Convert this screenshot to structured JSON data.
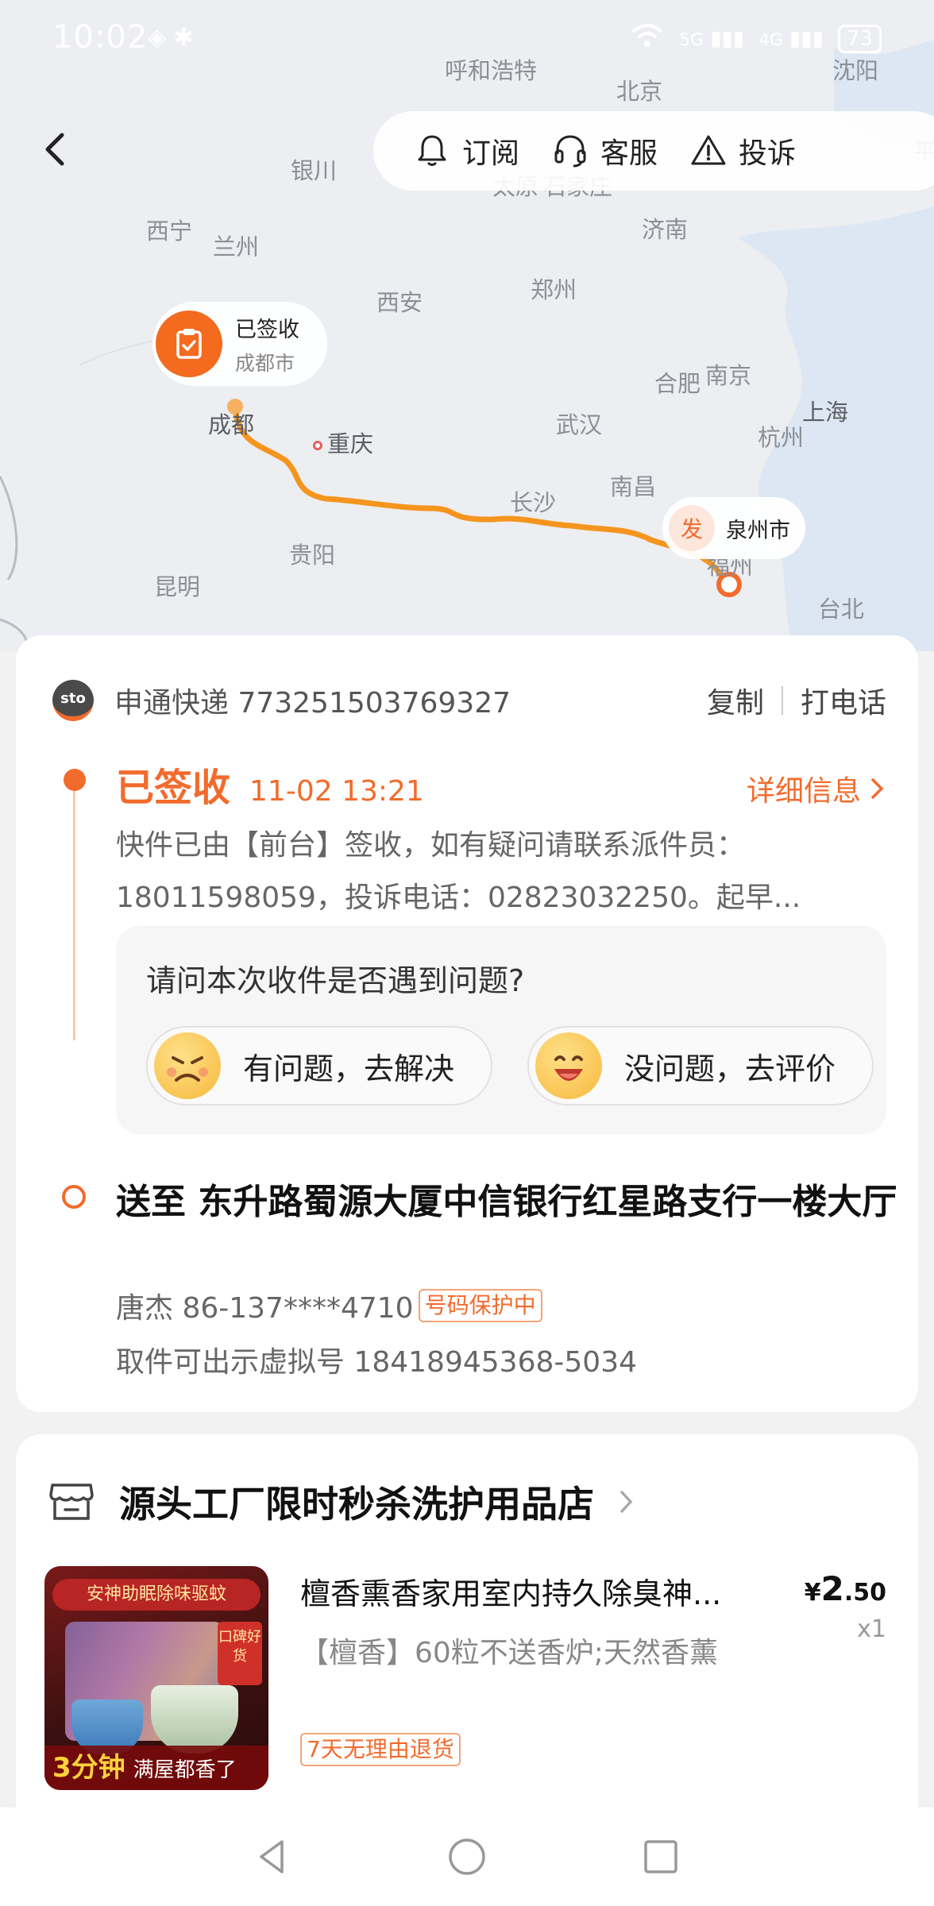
{
  "status_bar": {
    "time": "10:02",
    "network": "5G",
    "network2": "4G",
    "battery": "73"
  },
  "map": {
    "cities": [
      {
        "name": "呼和浩特"
      },
      {
        "name": "北京"
      },
      {
        "name": "沈阳"
      },
      {
        "name": "银川"
      },
      {
        "name": "太原"
      },
      {
        "name": "石家庄"
      },
      {
        "name": "西宁"
      },
      {
        "name": "兰州"
      },
      {
        "name": "济南"
      },
      {
        "name": "西安"
      },
      {
        "name": "郑州"
      },
      {
        "name": "合肥"
      },
      {
        "name": "南京"
      },
      {
        "name": "上海"
      },
      {
        "name": "成都"
      },
      {
        "name": "重庆"
      },
      {
        "name": "武汉"
      },
      {
        "name": "杭州"
      },
      {
        "name": "长沙"
      },
      {
        "name": "南昌"
      },
      {
        "name": "贵阳"
      },
      {
        "name": "昆明"
      },
      {
        "name": "福州"
      },
      {
        "name": "台北"
      },
      {
        "name": "平"
      }
    ],
    "signed_badge": {
      "label": "已签收",
      "city": "成都市"
    },
    "origin_badge": {
      "icon_text": "发",
      "city": "泉州市"
    },
    "route_color": "#f5951e"
  },
  "topbar": {
    "subscribe": "订阅",
    "service": "客服",
    "complaint": "投诉"
  },
  "shipment": {
    "courier_logo": "sto",
    "courier": "申通快递 773251503769327",
    "copy": "复制",
    "call": "打电话",
    "status": "已签收",
    "status_time": "11-02 13:21",
    "detail_link": "详细信息",
    "desc_line1": "快件已由【前台】签收，如有疑问请联系派件员：",
    "desc_line2": "18011598059，投诉电话：02823032250。起早...",
    "survey_question": "请问本次收件是否遇到问题?",
    "survey_problem": "有问题，去解决",
    "survey_ok": "没问题，去评价",
    "destination": "送至 东升路蜀源大厦中信银行红星路支行一楼大厅",
    "receiver": "唐杰 86-137****4710",
    "protect_tag": "号码保护中",
    "virtual_number": "取件可出示虚拟号 18418945368-5034"
  },
  "store": {
    "name": "源头工厂限时秒杀洗护用品店",
    "product": {
      "title": "檀香熏香家用室内持久除臭神...",
      "spec": "【檀香】60粒不送香炉;天然香薰",
      "tag": "7天无理由退货",
      "price_symbol": "¥",
      "price_int": "2",
      "price_dec": ".50",
      "qty": "x1",
      "img_banner": "安神助眠除味驱蚊",
      "img_seal": "口碑好货",
      "img_bottom_em": "3分钟",
      "img_bottom": "满屋都香了"
    }
  },
  "colors": {
    "accent": "#f26b2c"
  }
}
